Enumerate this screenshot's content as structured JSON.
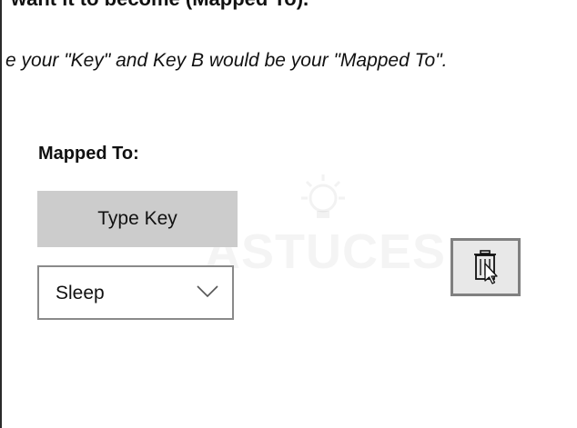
{
  "instructions": {
    "top_line": "want it to become (Mapped To).",
    "italic_line": "e your \"Key\" and Key B would be your \"Mapped To\"."
  },
  "mapping": {
    "mapped_to_label": "Mapped To:",
    "type_key_label": "Type Key",
    "selected_key": "Sleep"
  },
  "watermark": {
    "text": "ASTUCES"
  },
  "icons": {
    "delete": "trash-icon",
    "dropdown": "chevron-down-icon",
    "cursor": "arrow-cursor-icon"
  },
  "colors": {
    "type_key_bg": "#cccccc",
    "select_border": "#8a8a8a",
    "delete_border": "#808080",
    "delete_bg": "#e8e8e8"
  }
}
